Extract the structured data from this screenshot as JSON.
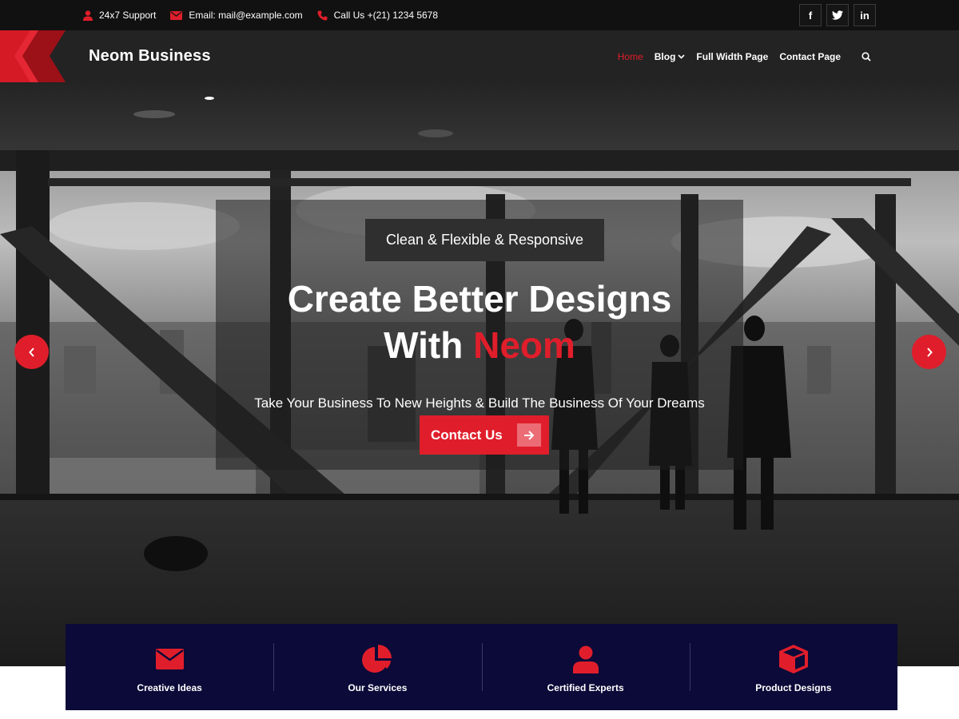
{
  "topbar": {
    "support": "24x7 Support",
    "email": "Email: mail@example.com",
    "phone": "Call Us +(21) 1234 5678",
    "socials": [
      "f",
      "twitter",
      "in"
    ]
  },
  "header": {
    "site_title": "Neom Business",
    "nav": [
      {
        "label": "Home",
        "active": true
      },
      {
        "label": "Blog",
        "has_dropdown": true
      },
      {
        "label": "Full Width Page"
      },
      {
        "label": "Contact Page"
      }
    ]
  },
  "hero": {
    "tagline": "Clean & Flexible & Responsive",
    "title_line1": "Create Better Designs",
    "title_line2_prefix": "With ",
    "title_highlight": "Neom",
    "subtitle": "Take Your Business To New Heights & Build The Business Of Your Dreams",
    "cta_label": "Contact Us"
  },
  "features": [
    {
      "label": "Creative Ideas",
      "icon": "envelope-icon"
    },
    {
      "label": "Our Services",
      "icon": "pie-chart-icon"
    },
    {
      "label": "Certified Experts",
      "icon": "user-icon"
    },
    {
      "label": "Product Designs",
      "icon": "cube-icon"
    }
  ],
  "colors": {
    "accent": "#e01e2b",
    "topbar": "#111111",
    "header": "#232323",
    "features_bg": "#0b0a38"
  }
}
